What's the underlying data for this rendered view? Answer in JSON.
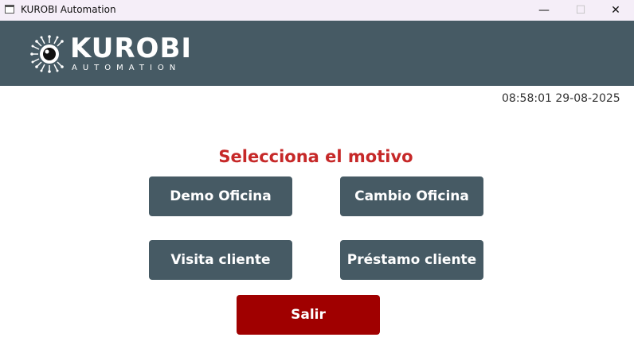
{
  "window": {
    "title": "KUROBI Automation",
    "minimize": "—",
    "maximize": "☐",
    "close": "✕"
  },
  "header": {
    "logo_text": "KUROBI",
    "logo_subtext": "AUTOMATION"
  },
  "clock": "08:58:01 29-08-2025",
  "main": {
    "heading": "Selecciona el motivo",
    "buttons": [
      "Demo Oficina",
      "Cambio Oficina",
      "Visita cliente",
      "Préstamo cliente"
    ],
    "exit": "Salir"
  },
  "colors": {
    "header_bg": "#465a64",
    "heading": "#c62828",
    "exit_bg": "#a00000"
  }
}
